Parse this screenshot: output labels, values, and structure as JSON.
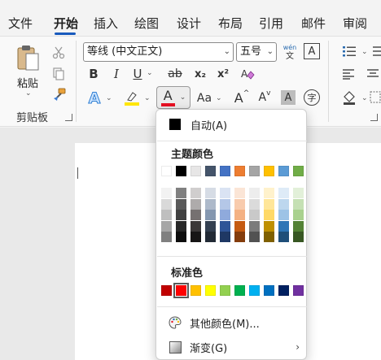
{
  "tabs": [
    "文件",
    "开始",
    "插入",
    "绘图",
    "设计",
    "布局",
    "引用",
    "邮件",
    "审阅"
  ],
  "active_tab": "开始",
  "clipboard": {
    "paste_label": "粘贴",
    "group_label": "剪贴板"
  },
  "font": {
    "name": "等线 (中文正文)",
    "size": "五号",
    "wen_top": "wén",
    "wen_bottom": "文",
    "bold": "B",
    "italic": "I",
    "underline": "U",
    "strike": "ab",
    "subscript": "x₂",
    "superscript": "x²",
    "font_color": "A",
    "font_color_value": "#e81123",
    "highlight_color_value": "#ffe600",
    "change_case": "Aa",
    "grow": "A",
    "shrink": "A",
    "char_shading": "A",
    "enclose": "字",
    "border_char": "A"
  },
  "dropdown": {
    "auto_label": "自动(A)",
    "auto_color": "#000000",
    "theme_title": "主题颜色",
    "theme_colors": [
      "#ffffff",
      "#000000",
      "#e7e6e6",
      "#44546a",
      "#4472c4",
      "#ed7d31",
      "#a5a5a5",
      "#ffc000",
      "#5b9bd5",
      "#70ad47"
    ],
    "theme_shades": [
      [
        "#f2f2f2",
        "#d9d9d9",
        "#bfbfbf",
        "#a6a6a6",
        "#808080"
      ],
      [
        "#808080",
        "#595959",
        "#404040",
        "#262626",
        "#0d0d0d"
      ],
      [
        "#d0cece",
        "#aeabab",
        "#767171",
        "#3b3838",
        "#171616"
      ],
      [
        "#d6dce5",
        "#adb9ca",
        "#8497b0",
        "#333f50",
        "#222a35"
      ],
      [
        "#dae3f3",
        "#b4c7e7",
        "#8faadc",
        "#2f5597",
        "#1f3864"
      ],
      [
        "#fbe5d6",
        "#f8cbad",
        "#f4b183",
        "#c55a11",
        "#843c0c"
      ],
      [
        "#ededed",
        "#dbdbdb",
        "#c9c9c9",
        "#7b7b7b",
        "#525252"
      ],
      [
        "#fff2cc",
        "#ffe699",
        "#ffd966",
        "#bf9000",
        "#7f6000"
      ],
      [
        "#deebf7",
        "#bdd7ee",
        "#9dc3e6",
        "#2e75b6",
        "#1f4e79"
      ],
      [
        "#e2f0d9",
        "#c5e0b4",
        "#a9d18e",
        "#548235",
        "#385723"
      ]
    ],
    "standard_title": "标准色",
    "standard_colors": [
      "#c00000",
      "#ff0000",
      "#ffc000",
      "#ffff00",
      "#92d050",
      "#00b050",
      "#00b0f0",
      "#0070c0",
      "#002060",
      "#7030a0"
    ],
    "more_colors_label": "其他颜色(M)...",
    "gradient_label": "渐变(G)"
  }
}
